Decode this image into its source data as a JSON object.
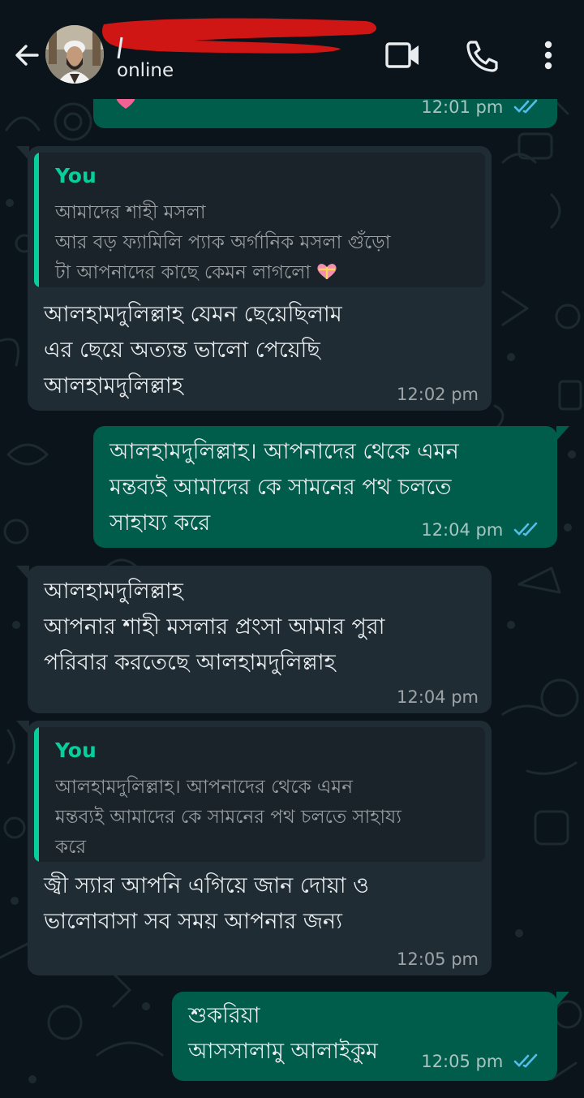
{
  "header": {
    "status": "online",
    "back_icon": "arrow-left-icon",
    "video_icon": "video-call-icon",
    "call_icon": "phone-icon",
    "menu_icon": "more-vertical-icon"
  },
  "colors": {
    "background": "#0b141a",
    "incoming_bubble": "#202c33",
    "outgoing_bubble": "#005c4b",
    "quote_accent": "#06cf9c",
    "read_ticks": "#53bdeb"
  },
  "messages": [
    {
      "id": "m0",
      "direction": "outgoing",
      "time": "12:01 pm",
      "status": "read"
    },
    {
      "id": "m1",
      "direction": "incoming",
      "quote": {
        "author": "You",
        "text": "আমাদের শাহী মসলা\nআর বড় ফ্যামিলি প্যাক অর্গানিক মসলা গুঁড়ো\nটা আপনাদের কাছে কেমন লাগলো"
      },
      "text": "আলহামদুলিল্লাহ যেমন ছেয়েছিলাম\nএর ছেয়ে অত্যন্ত ভালো পেয়েছি\nআলহামদুলিল্লাহ",
      "time": "12:02 pm"
    },
    {
      "id": "m2",
      "direction": "outgoing",
      "text": "আলহামদুলিল্লাহ। আপনাদের থেকে এমন\nমন্তব্যই আমাদের কে সামনের পথ চলতে\nসাহায্য করে",
      "time": "12:04 pm",
      "status": "read"
    },
    {
      "id": "m3",
      "direction": "incoming",
      "text": "আলহামদুলিল্লাহ\nআপনার শাহী মসলার প্রংসা আমার পুরা\nপরিবার করতেছে আলহামদুলিল্লাহ",
      "time": "12:04 pm"
    },
    {
      "id": "m4",
      "direction": "incoming",
      "quote": {
        "author": "You",
        "text": "আলহামদুলিল্লাহ। আপনাদের থেকে এমন\nমন্তব্যই আমাদের কে সামনের পথ চলতে সাহায্য\nকরে"
      },
      "text": "জ্বী স্যার আপনি এগিয়ে জান দোয়া ও\nভালোবাসা সব সময় আপনার জন্য",
      "time": "12:05 pm"
    },
    {
      "id": "m5",
      "direction": "outgoing",
      "text": "শুকরিয়া\nআসসালামু আলাইকুম",
      "time": "12:05 pm",
      "status": "read"
    }
  ]
}
